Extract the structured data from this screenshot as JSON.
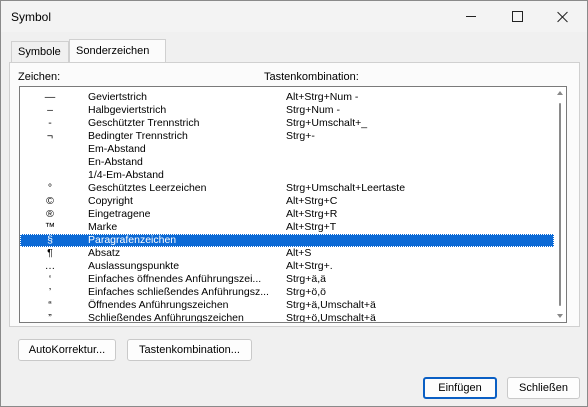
{
  "window": {
    "title": "Symbol"
  },
  "tabs": [
    {
      "label": "Symbole",
      "active": false
    },
    {
      "label": "Sonderzeichen",
      "active": true
    }
  ],
  "columns": {
    "zeichen": "Zeichen:",
    "tasten": "Tastenkombination:"
  },
  "rows": [
    {
      "sym": "—",
      "name": "Geviertstrich",
      "keys": "Alt+Strg+Num -"
    },
    {
      "sym": "–",
      "name": "Halbgeviertstrich",
      "keys": "Strg+Num -"
    },
    {
      "sym": "-",
      "name": "Geschützter Trennstrich",
      "keys": "Strg+Umschalt+_"
    },
    {
      "sym": "¬",
      "name": "Bedingter Trennstrich",
      "keys": "Strg+-"
    },
    {
      "sym": "",
      "name": "Em-Abstand",
      "keys": ""
    },
    {
      "sym": "",
      "name": "En-Abstand",
      "keys": ""
    },
    {
      "sym": "",
      "name": "1/4-Em-Abstand",
      "keys": ""
    },
    {
      "sym": "°",
      "name": "Geschütztes Leerzeichen",
      "keys": "Strg+Umschalt+Leertaste"
    },
    {
      "sym": "©",
      "name": "Copyright",
      "keys": "Alt+Strg+C"
    },
    {
      "sym": "®",
      "name": "Eingetragene",
      "keys": "Alt+Strg+R"
    },
    {
      "sym": "™",
      "name": "Marke",
      "keys": "Alt+Strg+T"
    },
    {
      "sym": "§",
      "name": "Paragrafenzeichen",
      "keys": "",
      "selected": true
    },
    {
      "sym": "¶",
      "name": "Absatz",
      "keys": "Alt+S"
    },
    {
      "sym": "…",
      "name": "Auslassungspunkte",
      "keys": "Alt+Strg+."
    },
    {
      "sym": "‘",
      "name": "Einfaches öffnendes Anführungszei...",
      "keys": "Strg+ä,ä"
    },
    {
      "sym": "’",
      "name": "Einfaches schließendes Anführungsz...",
      "keys": "Strg+ö,ö"
    },
    {
      "sym": "“",
      "name": "Öffnendes Anführungszeichen",
      "keys": "Strg+ä,Umschalt+ä"
    },
    {
      "sym": "”",
      "name": "Schließendes Anführungszeichen",
      "keys": "Strg+ö,Umschalt+ä"
    }
  ],
  "buttons": {
    "autokorrektur": "AutoKorrektur...",
    "tastenkombination": "Tastenkombination...",
    "einfuegen": "Einfügen",
    "schliessen": "Schließen"
  },
  "icons": {
    "minimize": "minimize-icon",
    "maximize": "maximize-icon",
    "close": "close-icon"
  },
  "colors": {
    "selection": "#0c6ad6",
    "default_button_border": "#0a5fc4"
  }
}
